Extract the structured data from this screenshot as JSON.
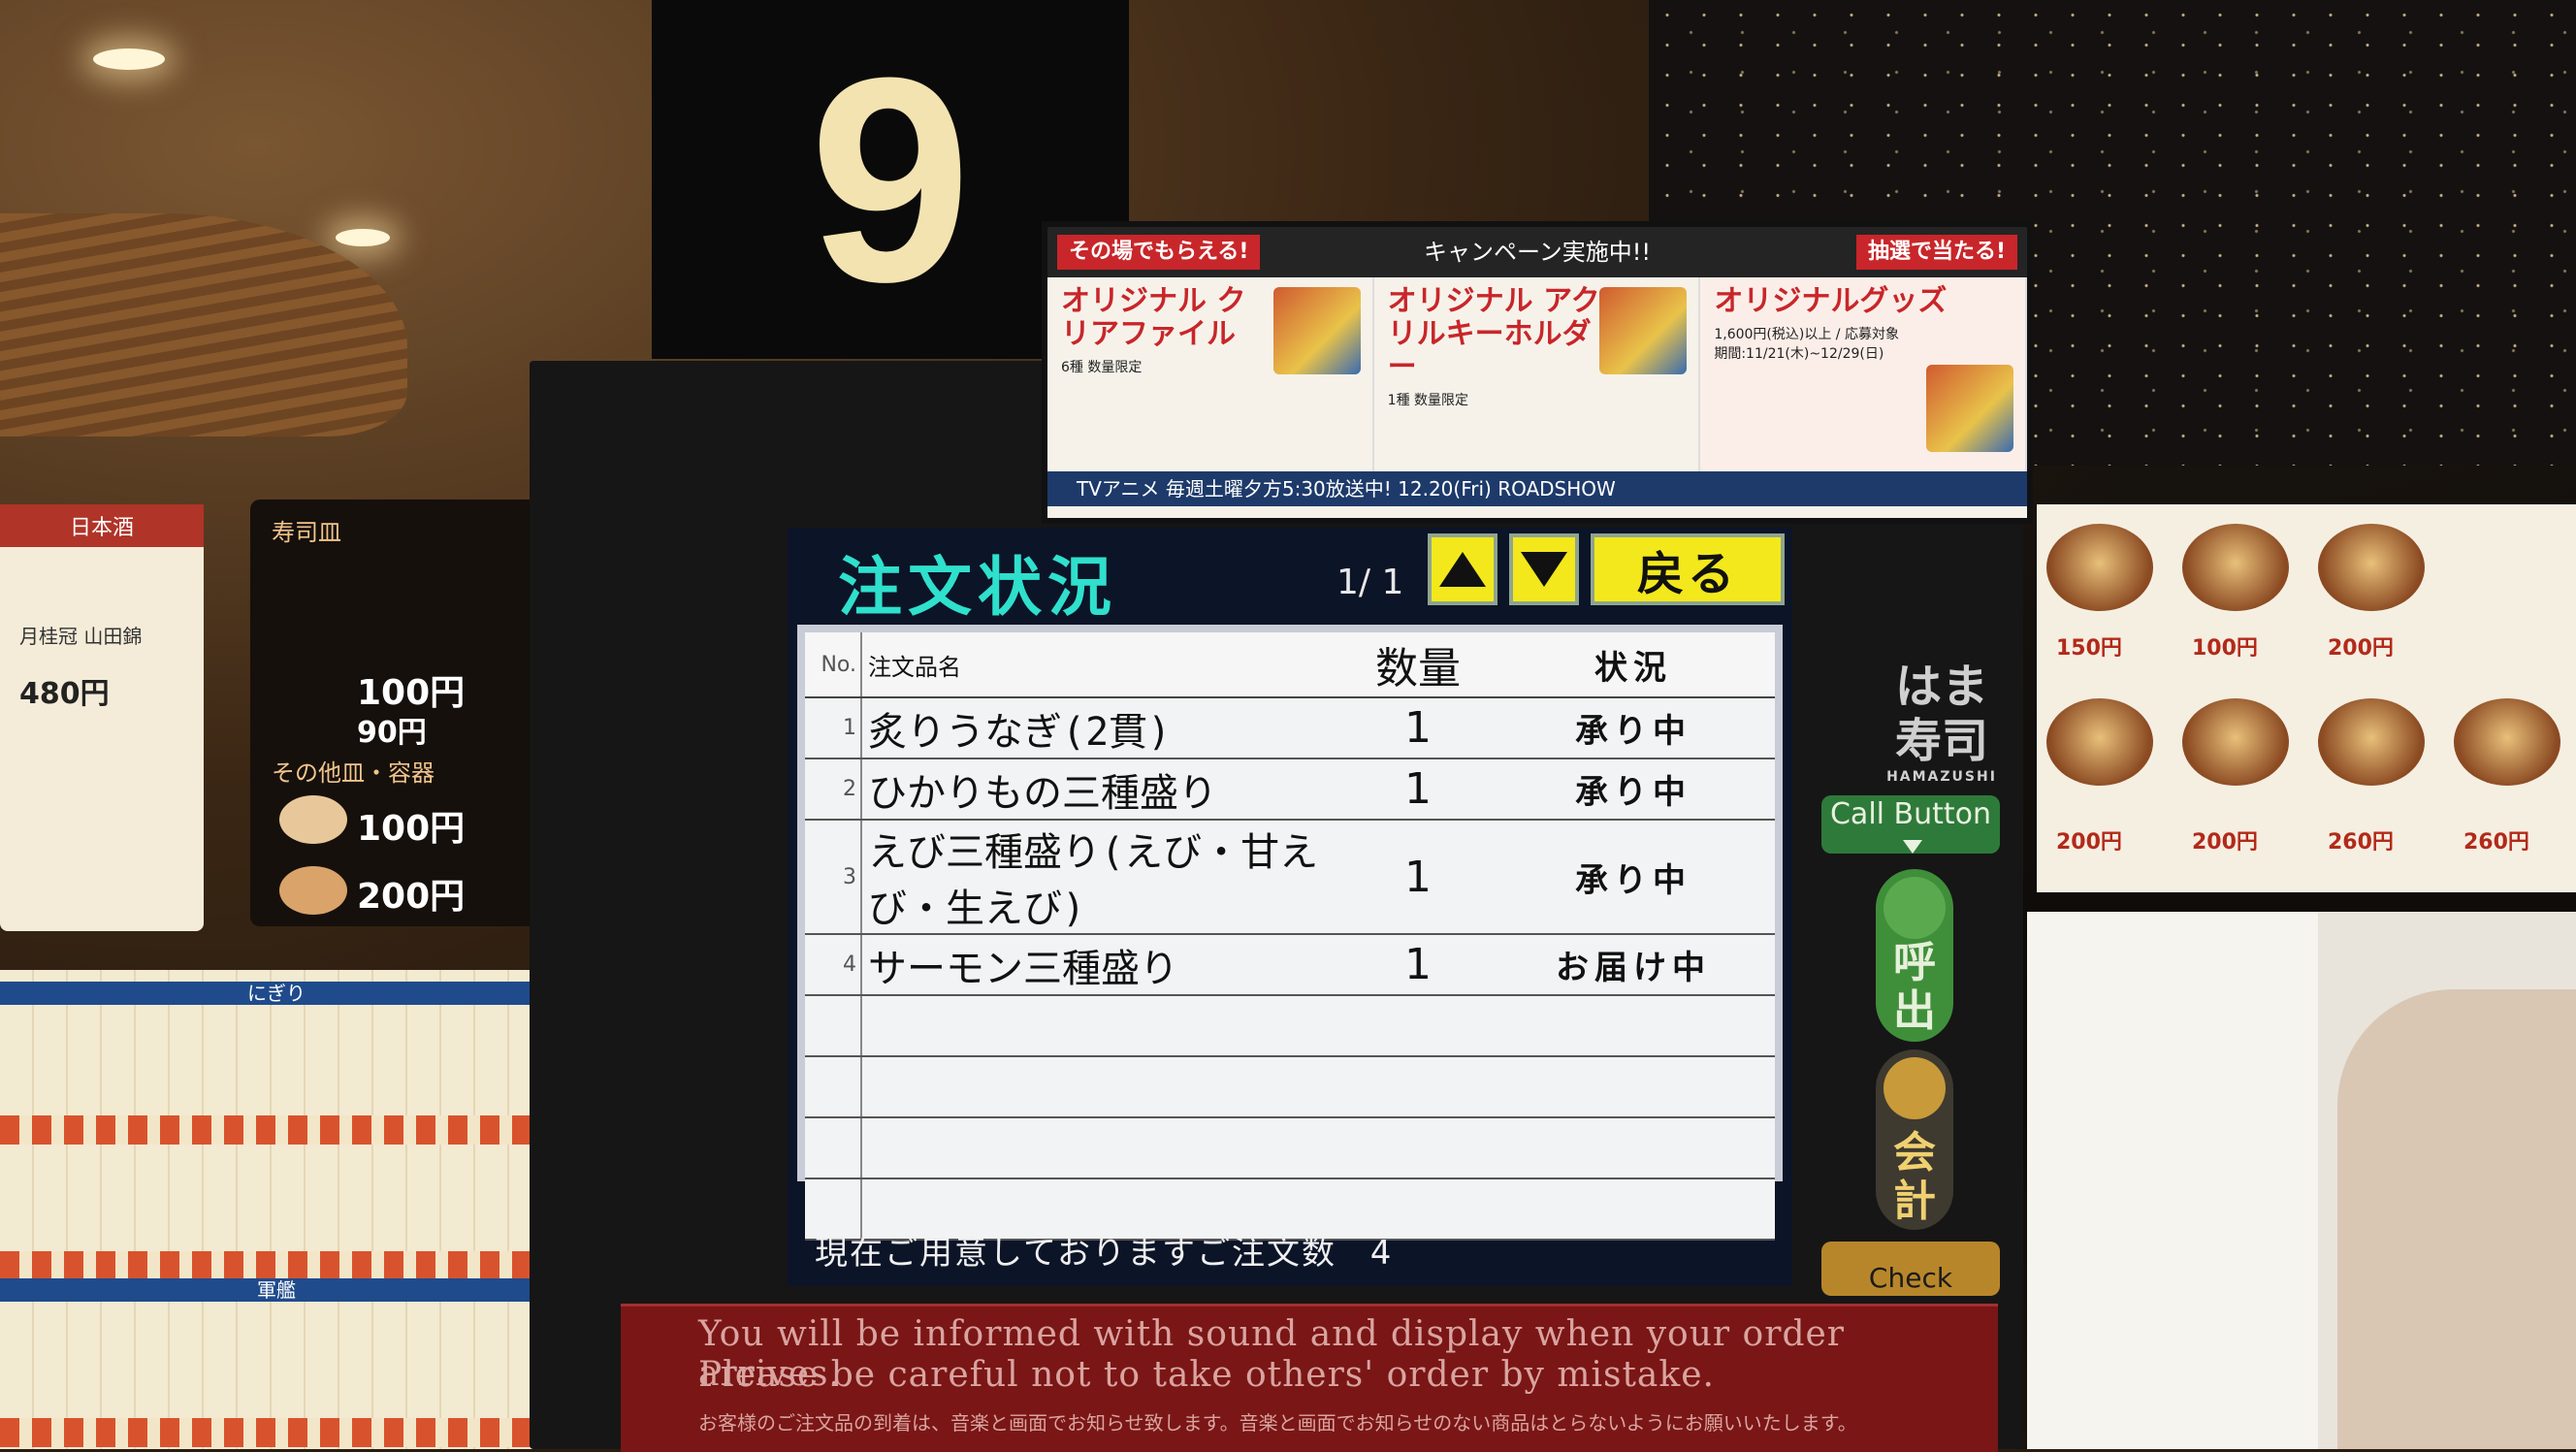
{
  "table_number": "9",
  "ad": {
    "tag_left": "その場でもらえる!",
    "tag_right": "抽選で当たる!",
    "headline": "キャンペーン実施中!!",
    "items": [
      {
        "title": "オリジナル クリアファイル",
        "note": "6種 数量限定"
      },
      {
        "title": "オリジナル アクリルキーホルダー",
        "note": "1種 数量限定"
      },
      {
        "title": "オリジナルグッズ",
        "note": "1,600円(税込)以上 / 応募対象期間:11/21(木)~12/29(日)"
      }
    ],
    "bottom": "TVアニメ 毎週土曜夕方5:30放送中! 12.20(Fri) ROADSHOW"
  },
  "screen": {
    "title": "注文状況",
    "page_indicator": "1/ 1",
    "back_label": "戻る",
    "columns": {
      "no": "No.",
      "name": "注文品名",
      "qty": "数量",
      "status": "状況"
    },
    "orders": [
      {
        "no": "1",
        "name": "炙りうなぎ(2貫)",
        "qty": "1",
        "status": "承り中"
      },
      {
        "no": "2",
        "name": "ひかりもの三種盛り",
        "qty": "1",
        "status": "承り中"
      },
      {
        "no": "3",
        "name": "えび三種盛り(えび・甘えび・生えび)",
        "qty": "1",
        "status": "承り中"
      },
      {
        "no": "4",
        "name": "サーモン三種盛り",
        "qty": "1",
        "status": "お届け中"
      }
    ],
    "ready_text": "現在ご用意しておりますご注文数",
    "ready_count": "4"
  },
  "controls": {
    "brand": "はま寿司",
    "brand_sub": "HAMAZUSHI",
    "call_button_label": "Call Button",
    "call_button_text": "呼出",
    "check_button_label": "Check Button",
    "check_button_text": "会計"
  },
  "notice": {
    "line1": "You will be informed with sound and display when your order arrives.",
    "line2": "Please be careful not to take others' order by mistake.",
    "line3": "お客様のご注文品の到着は、音楽と画面でお知らせ致します。音楽と画面でお知らせのない商品はとらないようにお願いいたします。"
  },
  "left_menu": {
    "drinks_header": "日本酒",
    "drink_name": "月桂冠 山田錦",
    "drink_price": "480円",
    "plates_header": "寿司皿",
    "plate_price_1": "100円",
    "plate_price_2": "90円",
    "other_header": "その他皿・容器",
    "plate_price_3": "100円",
    "plate_price_4": "200円",
    "nigiri_header": "にぎり",
    "gunkan_header": "軍艦"
  },
  "right_menu": {
    "prices": [
      "150円",
      "100円",
      "200円",
      "200円",
      "200円",
      "260円",
      "260円"
    ]
  }
}
